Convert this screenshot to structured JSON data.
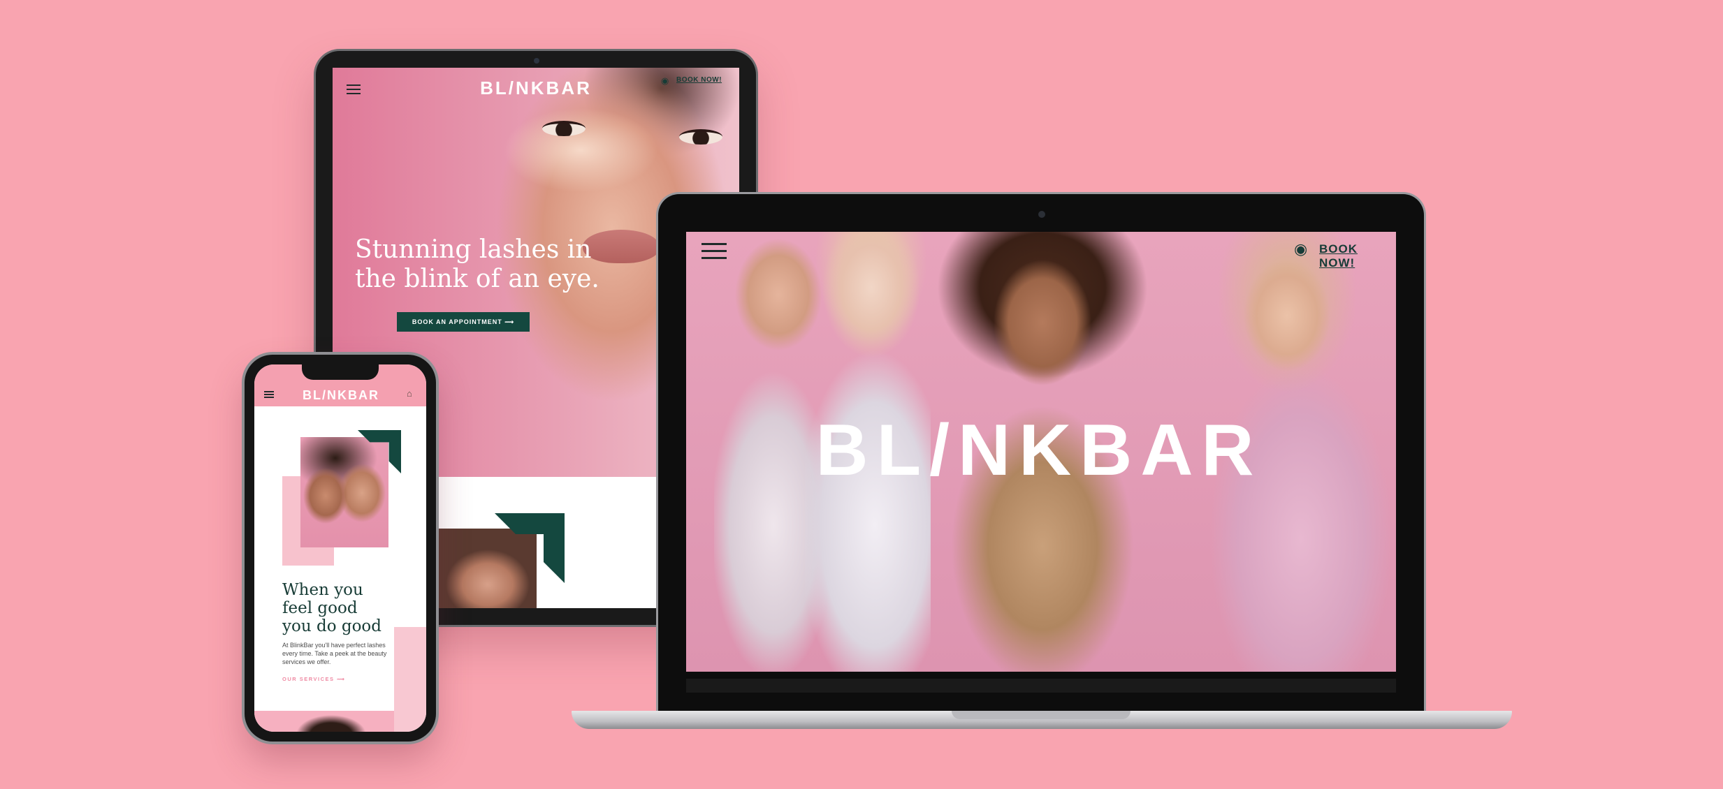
{
  "colors": {
    "background": "#f9a4b0",
    "brand_green": "#14483f",
    "brand_pink": "#f4a0b0"
  },
  "tablet": {
    "logo": "BL/NKBAR",
    "book_now": "BOOK NOW!",
    "headline_line1": "Stunning lashes in",
    "headline_line2": "the blink of an eye.",
    "cta": "BOOK AN APPOINTMENT ⟿",
    "icons": [
      "hamburger-menu-icon",
      "eye-icon",
      "corner-arrow-icon"
    ]
  },
  "laptop": {
    "logo": "BL/NKBAR",
    "book_now": "BOOK NOW!",
    "icons": [
      "hamburger-menu-icon",
      "eye-icon"
    ]
  },
  "phone": {
    "logo": "BL/NKBAR",
    "headline_line1": "When you",
    "headline_line2": "feel good",
    "headline_line3": "you do good",
    "body": "At BlinkBar you'll have perfect lashes every time. Take a peek at the beauty services we offer.",
    "services_link": "OUR SERVICES ⟿",
    "icons": [
      "hamburger-menu-icon",
      "cart-icon",
      "corner-arrow-icon"
    ]
  }
}
